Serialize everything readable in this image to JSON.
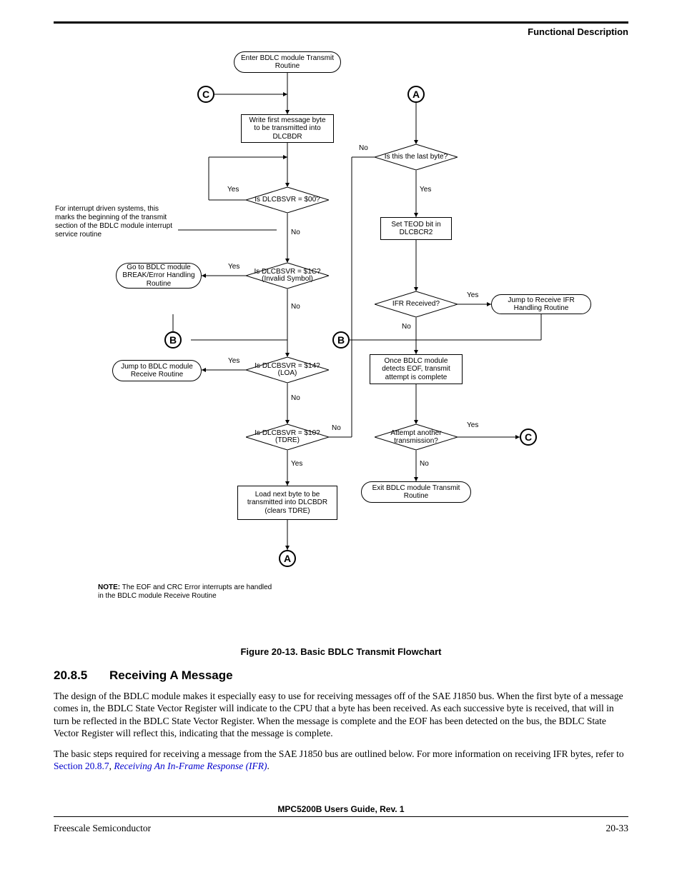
{
  "header": {
    "section_title": "Functional Description"
  },
  "chart_data": {
    "type": "flowchart",
    "title": "Basic BDLC Transmit Flowchart",
    "nodes": [
      {
        "id": "start",
        "type": "terminal",
        "text": "Enter BDLC module Transmit Routine"
      },
      {
        "id": "connC1",
        "type": "connector",
        "text": "C"
      },
      {
        "id": "connA1",
        "type": "connector",
        "text": "A"
      },
      {
        "id": "write1",
        "type": "process",
        "text": "Write first message byte to be transmitted into DLCBDR"
      },
      {
        "id": "d_last",
        "type": "decision",
        "text": "Is this the last byte?"
      },
      {
        "id": "d_00",
        "type": "decision",
        "text": "Is DLCBSVR = $00?"
      },
      {
        "id": "teod",
        "type": "process",
        "text": "Set TEOD bit in DLCBCR2"
      },
      {
        "id": "d_1c",
        "type": "decision",
        "text": "Is DLCBSVR = $1C? (Invalid Symbol)"
      },
      {
        "id": "brkerr",
        "type": "terminal",
        "text": "Go to BDLC module BREAK/Error Handling Routine"
      },
      {
        "id": "d_ifr",
        "type": "decision",
        "text": "IFR Received?"
      },
      {
        "id": "jmpifr",
        "type": "terminal",
        "text": "Jump to Receive IFR Handling Routine"
      },
      {
        "id": "connB1",
        "type": "connector",
        "text": "B"
      },
      {
        "id": "connB2",
        "type": "connector",
        "text": "B"
      },
      {
        "id": "d_14",
        "type": "decision",
        "text": "Is DLCBSVR = $14? (LOA)"
      },
      {
        "id": "jmprx",
        "type": "terminal",
        "text": "Jump to BDLC module Receive Routine"
      },
      {
        "id": "eof",
        "type": "process",
        "text": "Once BDLC module detects EOF, transmit attempt is complete"
      },
      {
        "id": "d_10",
        "type": "decision",
        "text": "Is DLCBSVR = $10? (TDRE)"
      },
      {
        "id": "d_again",
        "type": "decision",
        "text": "Attempt another transmission?"
      },
      {
        "id": "connC2",
        "type": "connector",
        "text": "C"
      },
      {
        "id": "loadnext",
        "type": "process",
        "text": "Load next byte to be transmitted into DLCBDR (clears TDRE)"
      },
      {
        "id": "exit",
        "type": "terminal",
        "text": "Exit BDLC module Transmit Routine"
      },
      {
        "id": "connA2",
        "type": "connector",
        "text": "A"
      }
    ],
    "edges": [
      {
        "from": "start",
        "to": "write1"
      },
      {
        "from": "connC1",
        "to": "write1"
      },
      {
        "from": "write1",
        "to": "d_00",
        "merge": "B-left-path joins here"
      },
      {
        "from": "d_00",
        "to": "d_1c",
        "label": "No"
      },
      {
        "from": "d_00",
        "to": "write1_loopback",
        "label": "Yes"
      },
      {
        "from": "d_1c",
        "to": "brkerr",
        "label": "Yes"
      },
      {
        "from": "d_1c",
        "to": "d_14",
        "label": "No"
      },
      {
        "from": "d_14",
        "to": "jmprx",
        "label": "Yes"
      },
      {
        "from": "d_14",
        "to": "d_10",
        "label": "No"
      },
      {
        "from": "d_10",
        "to": "loadnext",
        "label": "Yes"
      },
      {
        "from": "d_10",
        "to": "d_last",
        "label": "No",
        "via": "up right column to A path"
      },
      {
        "from": "loadnext",
        "to": "connA2"
      },
      {
        "from": "connA1",
        "to": "d_last"
      },
      {
        "from": "d_last",
        "to": "teod",
        "label": "Yes"
      },
      {
        "from": "d_last",
        "to": "d_10_loopback",
        "label": "No"
      },
      {
        "from": "teod",
        "to": "d_ifr"
      },
      {
        "from": "d_ifr",
        "to": "jmpifr",
        "label": "Yes"
      },
      {
        "from": "d_ifr",
        "to": "eof",
        "label": "No",
        "via": "connB2 joins above eof"
      },
      {
        "from": "jmpifr",
        "to": "eof",
        "via": "down then left"
      },
      {
        "from": "connB1",
        "to": "d_14"
      },
      {
        "from": "connB2",
        "to": "eof"
      },
      {
        "from": "eof",
        "to": "d_again"
      },
      {
        "from": "d_again",
        "to": "connC2",
        "label": "Yes"
      },
      {
        "from": "d_again",
        "to": "exit",
        "label": "No"
      }
    ],
    "annotations": [
      "For interrupt driven systems, this marks the beginning of the transmit section of the BDLC module interrupt service routine",
      "NOTE: The EOF and CRC Error interrupts are handled in the BDLC module Receive Routine"
    ]
  },
  "caption": {
    "label": "Figure 20-13.",
    "title": "Basic BDLC Transmit Flowchart"
  },
  "section": {
    "number": "20.8.5",
    "title": "Receiving A Message"
  },
  "paragraphs": {
    "p1": "The design of the BDLC module makes it especially easy to use for receiving messages off of the SAE J1850 bus. When the first byte of a message comes in, the BDLC State Vector Register will indicate to the CPU that a byte has been received. As each successive byte is received, that will in turn be reflected in the BDLC State Vector Register. When the message is complete and the EOF has been detected on the bus, the BDLC State Vector Register will reflect this, indicating that the message is complete.",
    "p2a": "The basic steps required for receiving a message from the SAE J1850 bus are outlined below. For more information on receiving IFR bytes, refer to ",
    "p2_link1": "Section 20.8.7",
    "p2_sep": ", ",
    "p2_link2": "Receiving An In-Frame Response (IFR)",
    "p2_tail": "."
  },
  "labels": {
    "no": "No",
    "yes": "Yes"
  },
  "note": {
    "bold": "NOTE:",
    "rest": " The EOF and CRC Error interrupts are handled in the BDLC module Receive Routine"
  },
  "annot1": "For interrupt driven systems, this marks the beginning of the transmit section of the BDLC module interrupt service routine",
  "footer": {
    "doc": "MPC5200B Users Guide, Rev. 1",
    "left": "Freescale Semiconductor",
    "right": "20-33"
  }
}
